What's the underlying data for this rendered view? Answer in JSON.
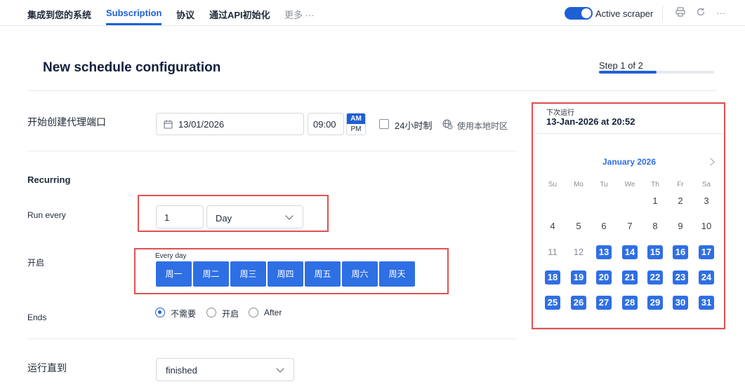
{
  "nav": {
    "tabs": [
      "集成到您的系统",
      "Subscription",
      "协议",
      "通过API初始化"
    ],
    "more_label": "更多 ···",
    "toggle_label": "Active scraper",
    "more_icon": "···"
  },
  "header": {
    "title": "New schedule configuration",
    "step_label": "Step 1 of 2",
    "step_progress": 0.5
  },
  "form": {
    "start_label": "开始创建代理端口",
    "date_value": "13/01/2026",
    "time_value": "09:00",
    "am_label": "AM",
    "pm_label": "PM",
    "hour24_label": "24小时制",
    "local_tz_label": "使用本地时区",
    "recurring_heading": "Recurring",
    "run_every_label": "Run every",
    "run_every_value": "1",
    "unit_value": "Day",
    "on_label": "开启",
    "every_day_caption": "Every day",
    "days": [
      "周一",
      "周二",
      "周三",
      "周四",
      "周五",
      "周六",
      "周天"
    ],
    "ends_label": "Ends",
    "ends_options": [
      "不需要",
      "开启",
      "After"
    ],
    "ends_selected": 0,
    "run_until_label": "运行直到",
    "run_until_value": "finished"
  },
  "calendar": {
    "next_run_label": "下次运行",
    "next_run_value": "13-Jan-2026 at 20:52",
    "month_label": "January 2026",
    "weekdays": [
      "Su",
      "Mo",
      "Tu",
      "We",
      "Th",
      "Fr",
      "Sa"
    ],
    "weeks": [
      [
        "",
        "",
        "",
        "",
        "1",
        "2",
        "3"
      ],
      [
        "4",
        "5",
        "6",
        "7",
        "8",
        "9",
        "10"
      ],
      [
        "11",
        "12",
        "13",
        "14",
        "15",
        "16",
        "17"
      ],
      [
        "18",
        "19",
        "20",
        "21",
        "22",
        "23",
        "24"
      ],
      [
        "25",
        "26",
        "27",
        "28",
        "29",
        "30",
        "31"
      ]
    ],
    "selected_from": 13,
    "selected_to": 31
  },
  "colors": {
    "accent": "#1f5fd6",
    "day_button": "#2f6fe4",
    "highlight_border": "#e05252"
  },
  "icons": {
    "calendar_icon": "calendar-icon",
    "globe_icon": "globe-clock-icon",
    "print_icon": "printer-icon",
    "refresh_icon": "refresh-icon",
    "more_icon": "more-horizontal-icon"
  }
}
